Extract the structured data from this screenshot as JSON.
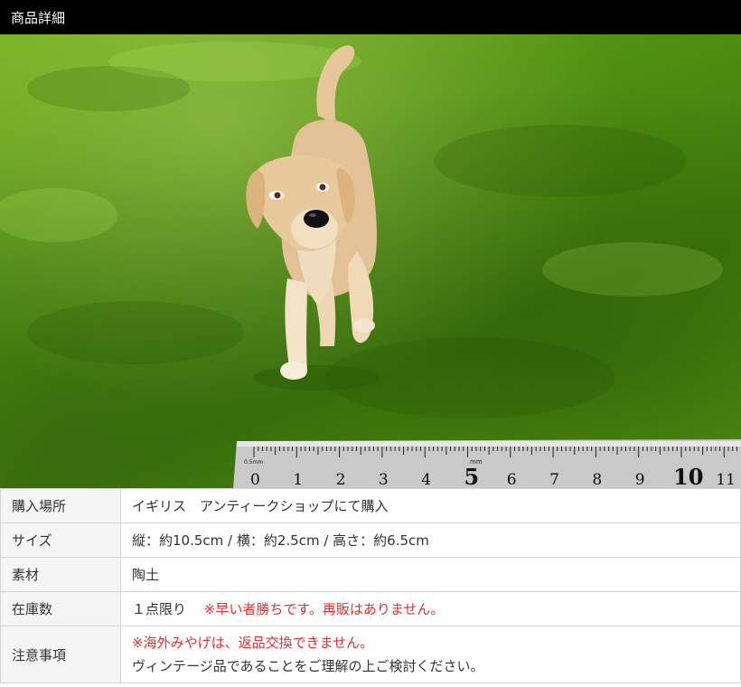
{
  "header": {
    "title": "商品詳細"
  },
  "photo": {
    "ruler_numbers": [
      "0",
      "1",
      "2",
      "3",
      "4",
      "5",
      "6",
      "7",
      "8",
      "9",
      "10",
      "11"
    ],
    "ruler_unit_small": "0.5mm",
    "ruler_unit_mm": "mm"
  },
  "specs": [
    {
      "label": "購入場所",
      "value": "イギリス　アンティークショップにて購入"
    },
    {
      "label": "サイズ",
      "value": "縦：約10.5cm / 横：約2.5cm / 高さ：約6.5cm"
    },
    {
      "label": "素材",
      "value": "陶土"
    },
    {
      "label": "在庫数",
      "value": "１点限り",
      "note": "※早い者勝ちです。再販はありません。"
    },
    {
      "label": "注意事項",
      "note": "※海外みやげは、返品交換できません。",
      "value": "ヴィンテージ品であることをご理解の上ご検討ください。"
    }
  ],
  "colors": {
    "accent_red": "#e03030",
    "header_bg": "#000000"
  }
}
